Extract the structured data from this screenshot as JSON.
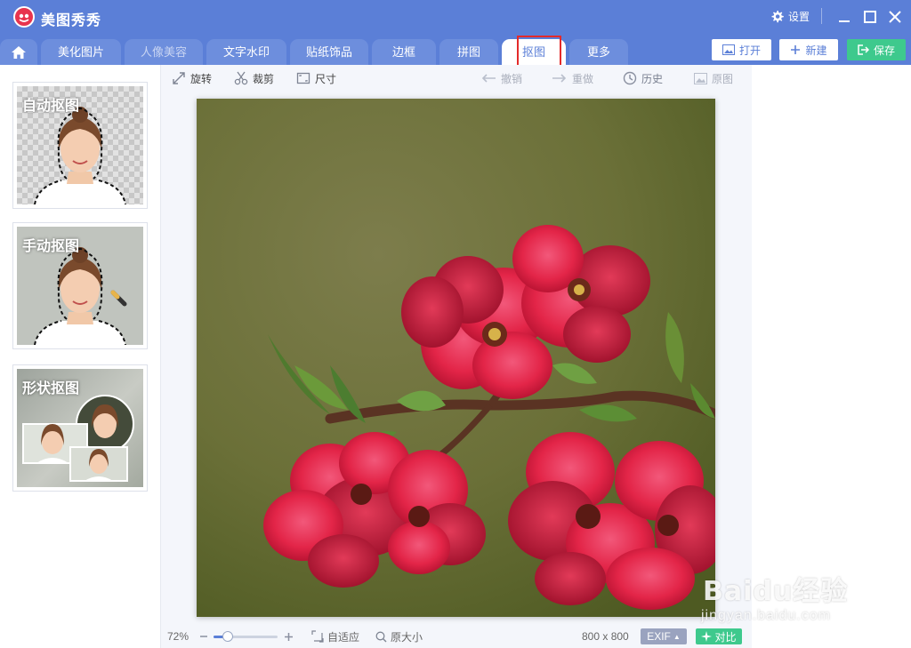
{
  "app": {
    "title": "美图秀秀",
    "settings_label": "设置"
  },
  "tabs": [
    {
      "label": "美化图片",
      "state": "normal"
    },
    {
      "label": "人像美容",
      "state": "dim"
    },
    {
      "label": "文字水印",
      "state": "normal"
    },
    {
      "label": "贴纸饰品",
      "state": "normal"
    },
    {
      "label": "边框",
      "state": "normal"
    },
    {
      "label": "拼图",
      "state": "normal"
    },
    {
      "label": "抠图",
      "state": "active"
    },
    {
      "label": "更多",
      "state": "normal"
    }
  ],
  "actions": {
    "open": "打开",
    "new": "新建",
    "save": "保存"
  },
  "sidebar": {
    "cards": [
      {
        "title": "自动抠图"
      },
      {
        "title": "手动抠图"
      },
      {
        "title": "形状抠图"
      }
    ]
  },
  "toolbar": {
    "rotate": "旋转",
    "crop": "裁剪",
    "size": "尺寸",
    "undo": "撤销",
    "redo": "重做",
    "history": "历史",
    "original": "原图"
  },
  "status": {
    "zoom": "72%",
    "zoom_level": 0.22,
    "fit": "自适应",
    "actual_size": "原大小",
    "dimensions": "800 x 800",
    "exif": "EXIF",
    "compare": "对比"
  },
  "watermark": {
    "brand": "Baidu经验",
    "url": "jingyan.baidu.com"
  },
  "colors": {
    "accent": "#5b7fd7",
    "save": "#3ec98d",
    "highlight": "#e42a2a",
    "compare": "#3ec98d",
    "exif": "#9aa3bf"
  }
}
